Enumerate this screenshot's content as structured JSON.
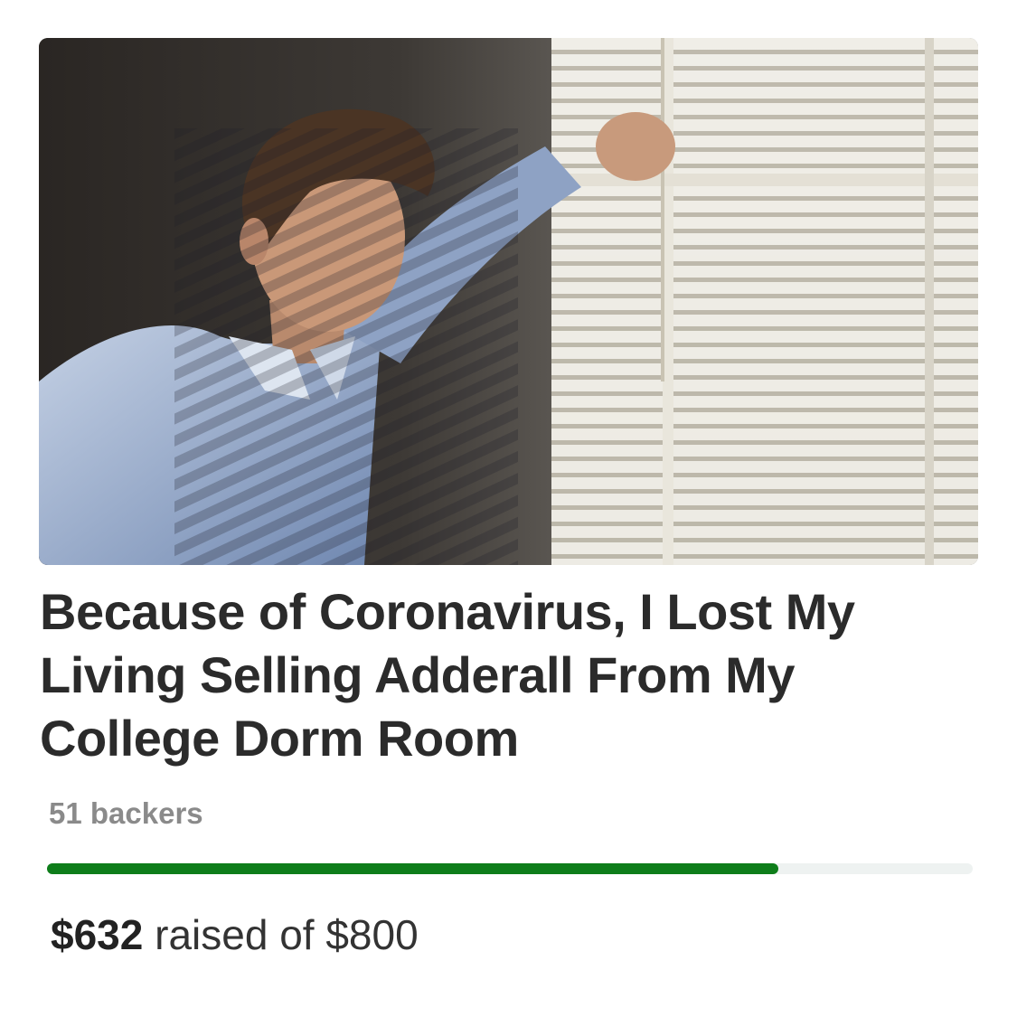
{
  "campaign": {
    "title": "Because of Coronavirus, I Lost My Living Selling Adderall From My College Dorm Room",
    "backers_text": "51 backers",
    "raised_amount": "$632",
    "raised_suffix": "raised of $800",
    "progress_fraction": 0.79,
    "progress_color": "#0e7d1a",
    "track_color": "#eef2f1",
    "hero_image_alt": "man-looking-out-window-through-blinds"
  }
}
